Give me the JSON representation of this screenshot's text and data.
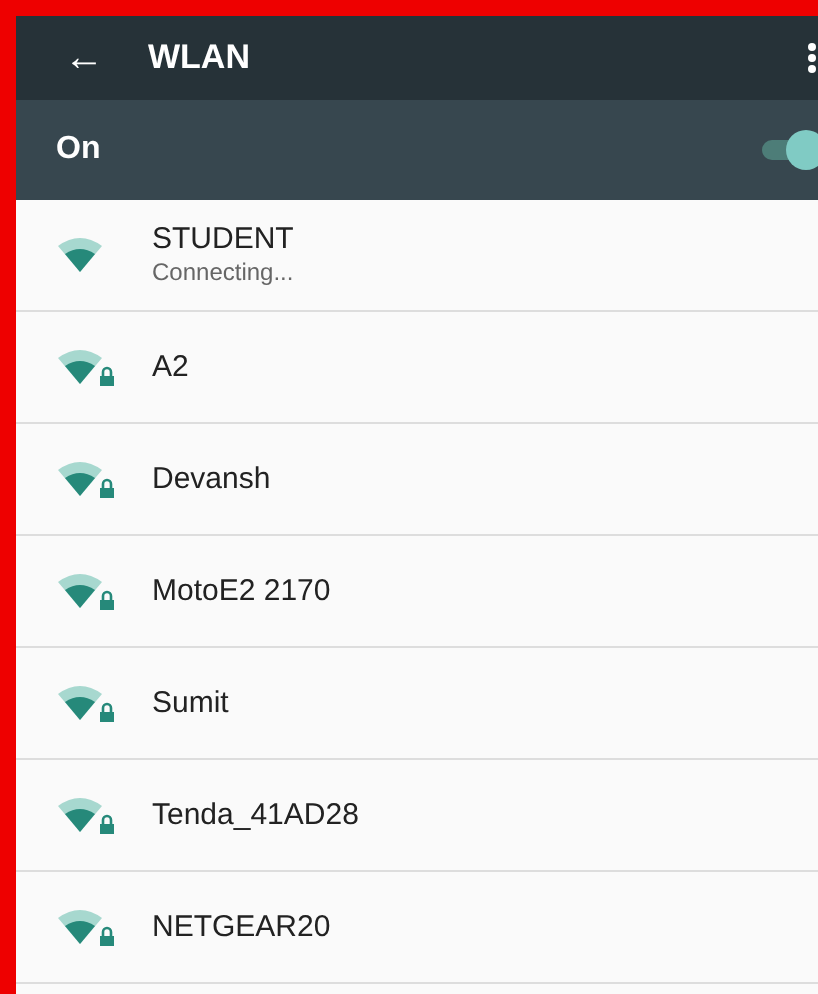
{
  "app_bar": {
    "back_icon": "←",
    "title": "WLAN"
  },
  "master_switch": {
    "label": "On",
    "on": true
  },
  "networks": [
    {
      "name": "STUDENT",
      "status": "Connecting...",
      "secured": false
    },
    {
      "name": "A2",
      "secured": true
    },
    {
      "name": "Devansh",
      "secured": true
    },
    {
      "name": "MotoE2 2170",
      "secured": true
    },
    {
      "name": "Sumit",
      "secured": true
    },
    {
      "name": "Tenda_41AD28",
      "secured": true
    },
    {
      "name": "NETGEAR20",
      "secured": true
    }
  ]
}
